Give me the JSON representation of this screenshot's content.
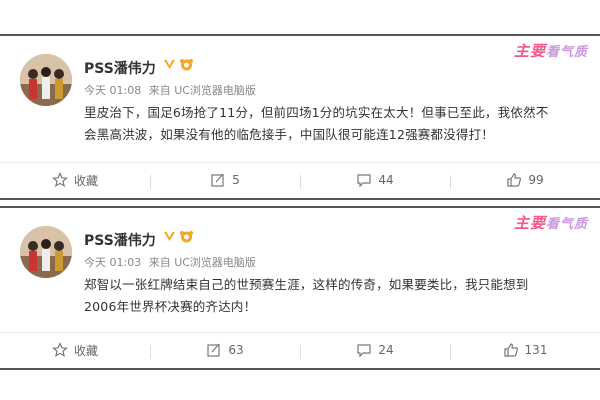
{
  "watermark": {
    "part1": "主要",
    "part2": "看气质"
  },
  "posts": [
    {
      "username": "PSS潘伟力",
      "time": "今天 01:08",
      "source": "来自 UC浏览器电脑版",
      "content": "里皮治下，国足6场抢了11分，但前四场1分的坑实在太大！但事已至此，我依然不会黑高洪波，如果没有他的临危接手，中国队很可能连12强赛都没得打！",
      "actions": {
        "favorite": "收藏",
        "repost": "5",
        "comment": "44",
        "like": "99"
      }
    },
    {
      "username": "PSS潘伟力",
      "time": "今天 01:03",
      "source": "来自 UC浏览器电脑版",
      "content": "郑智以一张红牌结束自己的世预赛生涯，这样的传奇，如果要类比，我只能想到2006年世界杯决赛的齐达内！",
      "actions": {
        "favorite": "收藏",
        "repost": "63",
        "comment": "24",
        "like": "131"
      }
    }
  ],
  "colors": {
    "accent": "#f05a8a",
    "verify": "#f5a623",
    "text": "#333333",
    "meta": "#888888"
  }
}
